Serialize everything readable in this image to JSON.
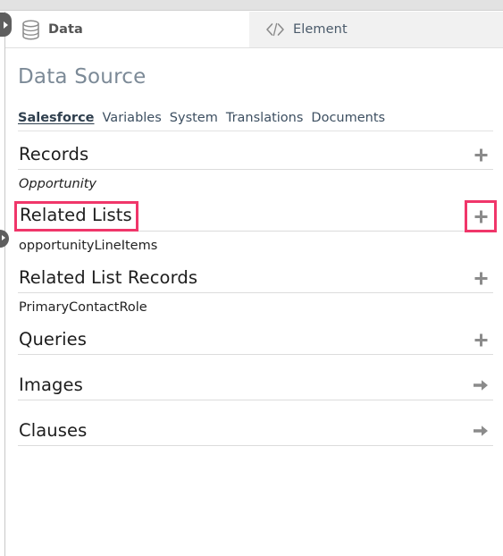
{
  "window": {
    "top_strip_color": "#e2e2e2"
  },
  "tabs": [
    {
      "id": "data",
      "label": "Data",
      "icon": "database-icon",
      "active": true
    },
    {
      "id": "element",
      "label": "Element",
      "icon": "code-brackets-icon",
      "active": false
    }
  ],
  "panel": {
    "title": "Data Source"
  },
  "subnav": {
    "items": [
      {
        "label": "Salesforce",
        "selected": true
      },
      {
        "label": "Variables",
        "selected": false
      },
      {
        "label": "System",
        "selected": false
      },
      {
        "label": "Translations",
        "selected": false
      },
      {
        "label": "Documents",
        "selected": false
      }
    ]
  },
  "sections": [
    {
      "id": "records",
      "title": "Records",
      "action_icon": "plus-icon",
      "title_highlighted": false,
      "action_highlighted": false,
      "items": [
        {
          "label": "Opportunity",
          "italic": true
        }
      ]
    },
    {
      "id": "related-lists",
      "title": "Related Lists",
      "action_icon": "plus-icon",
      "title_highlighted": true,
      "action_highlighted": true,
      "items": [
        {
          "label": "opportunityLineItems",
          "italic": false
        }
      ]
    },
    {
      "id": "related-list-records",
      "title": "Related List Records",
      "action_icon": "plus-icon",
      "title_highlighted": false,
      "action_highlighted": false,
      "items": [
        {
          "label": "PrimaryContactRole",
          "italic": false
        }
      ]
    },
    {
      "id": "queries",
      "title": "Queries",
      "action_icon": "plus-icon",
      "title_highlighted": false,
      "action_highlighted": false,
      "items": []
    },
    {
      "id": "images",
      "title": "Images",
      "action_icon": "arrow-right-icon",
      "title_highlighted": false,
      "action_highlighted": false,
      "items": []
    },
    {
      "id": "clauses",
      "title": "Clauses",
      "action_icon": "arrow-right-icon",
      "title_highlighted": false,
      "action_highlighted": false,
      "items": []
    }
  ],
  "edge_handles": [
    {
      "id": "panel-collapse-top",
      "icon": "chevron-right-icon"
    },
    {
      "id": "panel-collapse-mid",
      "icon": "chevron-right-icon"
    }
  ],
  "colors": {
    "highlight": "#f0366a",
    "icon_gray": "#8b8b8b",
    "title_gray": "#7c8a97",
    "link_blue_gray": "#3d4f61"
  }
}
